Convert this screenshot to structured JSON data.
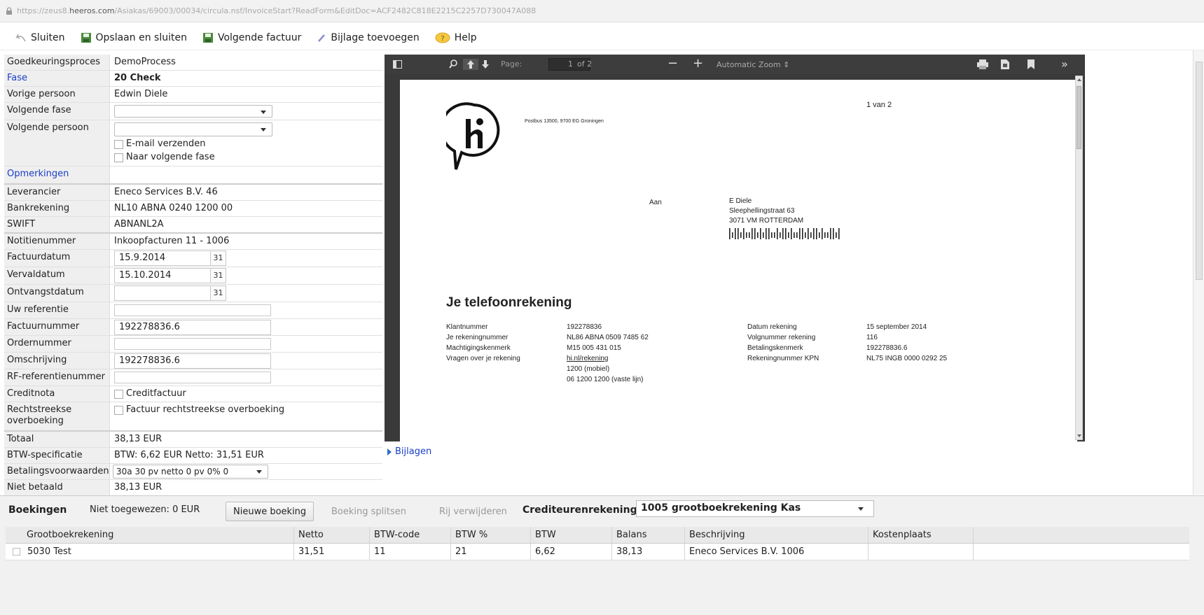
{
  "browser": {
    "url_prefix": "https://zeus8.",
    "url_domain": "heeros.com",
    "url_path": "/Asiakas/69003/00034/circula.nsf/InvoiceStart?ReadForm&EditDoc=ACF2482C818E2215C2257D730047A088"
  },
  "toolbar": {
    "close_label": "Sluiten",
    "save_close_label": "Opslaan en sluiten",
    "next_invoice_label": "Volgende factuur",
    "attachment_label": "Bijlage toevoegen",
    "help_label": "Help"
  },
  "form": {
    "approval_process": {
      "label": "Goedkeuringsproces",
      "value": "DemoProcess"
    },
    "phase": {
      "label": "Fase",
      "value": "20 Check"
    },
    "previous_person": {
      "label": "Vorige persoon",
      "value": "Edwin Diele"
    },
    "next_phase": {
      "label": "Volgende fase",
      "value": ""
    },
    "next_person": {
      "label": "Volgende persoon",
      "value": ""
    },
    "send_email_label": "E-mail verzenden",
    "to_next_phase_label": "Naar volgende fase",
    "remarks": {
      "label": "Opmerkingen"
    },
    "supplier": {
      "label": "Leverancier",
      "value": "Eneco Services B.V. 46"
    },
    "bank_account": {
      "label": "Bankrekening",
      "value": "NL10 ABNA 0240 1200 00"
    },
    "swift": {
      "label": "SWIFT",
      "value": "ABNANL2A"
    },
    "note_number": {
      "label": "Notitienummer",
      "value": "Inkoopfacturen 11 - 1006"
    },
    "invoice_date": {
      "label": "Factuurdatum",
      "value": "15.9.2014"
    },
    "due_date": {
      "label": "Vervaldatum",
      "value": "15.10.2014"
    },
    "receipt_date": {
      "label": "Ontvangstdatum",
      "value": ""
    },
    "calendar_day": "31",
    "your_reference": {
      "label": "Uw referentie",
      "value": ""
    },
    "invoice_number": {
      "label": "Factuurnummer",
      "value": "192278836.6"
    },
    "order_number": {
      "label": "Ordernummer",
      "value": ""
    },
    "description": {
      "label": "Omschrijving",
      "value": "192278836.6"
    },
    "rf_reference": {
      "label": "RF-referentienummer",
      "value": ""
    },
    "credit_note": {
      "label": "Creditnota",
      "checkbox_label": "Creditfactuur"
    },
    "direct_transfer": {
      "label": "Rechtstreekse overboeking",
      "checkbox_label": "Factuur rechtstreekse overboeking"
    },
    "total": {
      "label": "Totaal",
      "value": "38,13 EUR"
    },
    "vat_spec": {
      "label": "BTW-specificatie",
      "value": "BTW: 6,62 EUR  Netto: 31,51 EUR"
    },
    "payment_terms": {
      "label": "Betalingsvoorwaarden",
      "value": "30a 30 pv netto 0 pv 0% 0"
    },
    "unpaid": {
      "label": "Niet betaald",
      "value": "38,13 EUR"
    }
  },
  "pdf_viewer": {
    "page_label": "Page:",
    "page_value": "1",
    "page_of": "of 2",
    "zoom_label": "Automatic Zoom"
  },
  "invoice_doc": {
    "page_counter": "1 van 2",
    "sender_address": "Postbus 13500, 9700 EG Groningen",
    "to_label": "Aan",
    "recipient_name": "E Diele",
    "recipient_street": "Sleephellingstraat 63",
    "recipient_city": "3071 VM ROTTERDAM",
    "heading": "Je telefoonrekening",
    "left_labels": [
      "Klantnummer",
      "Je rekeningnummer",
      "Machtigingskenmerk",
      "Vragen over je rekening"
    ],
    "left_values": [
      "192278836",
      "NL86 ABNA 0509 7485 62",
      "M15 005 431 015",
      "hi.nl/rekening"
    ],
    "contact_lines": [
      "1200 (mobiel)",
      "06 1200 1200 (vaste lijn)"
    ],
    "right_labels": [
      "Datum rekening",
      "Volgnummer rekening",
      "Betalingskenmerk",
      "Rekeningnummer KPN"
    ],
    "right_values": [
      "15 september 2014",
      "116",
      "192278836.6",
      "NL75 INGB 0000 0292 25"
    ]
  },
  "attachments_label": "Bijlagen",
  "bookings": {
    "title": "Boekingen",
    "unassigned": "Niet toegewezen: 0 EUR",
    "new_booking": "Nieuwe boeking",
    "split_booking": "Boeking splitsen",
    "delete_row": "Rij verwijderen",
    "creditor_account_label": "Crediteurenrekening",
    "creditor_account_value": "1005 grootboekrekening Kas",
    "columns": [
      "Grootboekrekening",
      "Netto",
      "BTW-code",
      "BTW %",
      "BTW",
      "Balans",
      "Beschrijving",
      "Kostenplaats"
    ],
    "rows": [
      [
        "5030 Test",
        "31,51",
        "11",
        "21",
        "6,62",
        "38,13",
        "Eneco Services B.V. 1006",
        ""
      ]
    ]
  },
  "colors": {
    "link_blue": "#1a3ec8",
    "label_bg": "#efefef",
    "pdf_bg": "#3a3a3a"
  }
}
